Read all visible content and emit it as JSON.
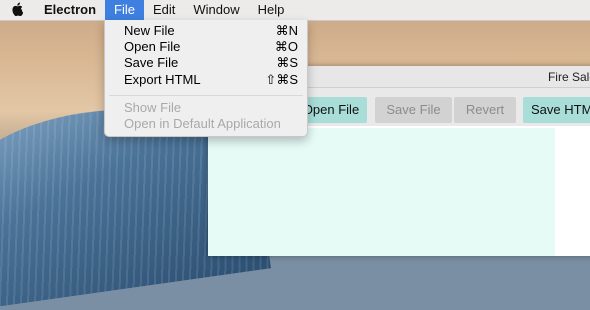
{
  "menubar": {
    "apple_icon": "apple-icon",
    "app_name": "Electron",
    "menus": [
      "File",
      "Edit",
      "Window",
      "Help"
    ],
    "active_menu": "File"
  },
  "file_menu": {
    "items": [
      {
        "label": "New File",
        "shortcut": "⌘N",
        "enabled": true
      },
      {
        "label": "Open File",
        "shortcut": "⌘O",
        "enabled": true
      },
      {
        "label": "Save File",
        "shortcut": "⌘S",
        "enabled": true
      },
      {
        "label": "Export HTML",
        "shortcut": "⇧⌘S",
        "enabled": true
      },
      {
        "label": "Show File",
        "shortcut": "",
        "enabled": false
      },
      {
        "label": "Open in Default Application",
        "shortcut": "",
        "enabled": false
      }
    ]
  },
  "window": {
    "title": "Fire Sale",
    "toolbar": {
      "open_file": "Open File",
      "save_file": "Save File",
      "revert": "Revert",
      "save_html": "Save HTM"
    }
  },
  "colors": {
    "menu_highlight": "#3f7fe0",
    "button_enabled": "#a9ddd8",
    "button_disabled": "#d2d2d2",
    "editor_bg": "#e6fbf6"
  }
}
